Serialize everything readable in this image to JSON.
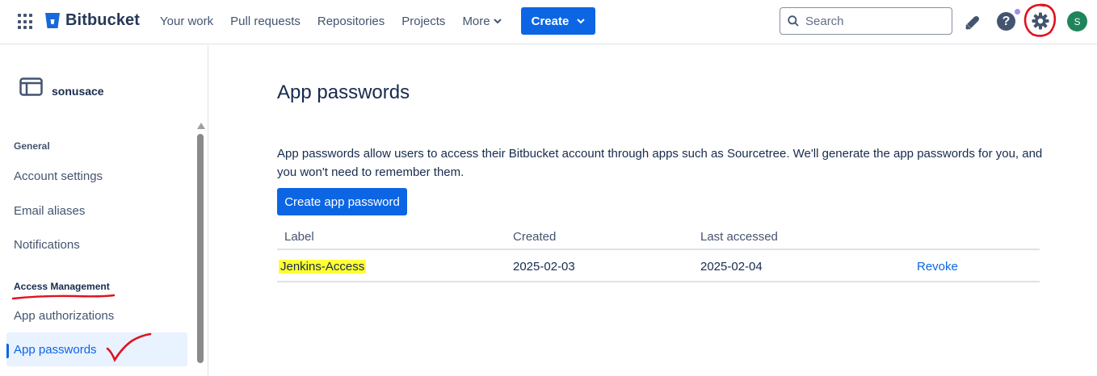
{
  "topnav": {
    "app_name": "Bitbucket",
    "nav_items": [
      "Your work",
      "Pull requests",
      "Repositories",
      "Projects"
    ],
    "more_label": "More",
    "create_label": "Create",
    "search_placeholder": "Search",
    "help_label": "?",
    "avatar_initial": "S"
  },
  "sidebar": {
    "workspace_name": "sonusace",
    "section_general": "General",
    "general_items": [
      "Account settings",
      "Email aliases",
      "Notifications"
    ],
    "section_access": "Access Management",
    "access_items": [
      "App authorizations",
      "App passwords"
    ]
  },
  "main": {
    "title": "App passwords",
    "description": "App passwords allow users to access their Bitbucket account through apps such as Sourcetree. We'll generate the app passwords for you, and you won't need to remember them.",
    "create_button": "Create app password",
    "table": {
      "headers": [
        "Label",
        "Created",
        "Last accessed"
      ],
      "rows": [
        {
          "label": "Jenkins-Access",
          "created": "2025-02-03",
          "last_accessed": "2025-02-04",
          "action": "Revoke"
        }
      ]
    }
  },
  "colors": {
    "brand_blue": "#0c66e4",
    "highlight": "#ffff33",
    "annotation_red": "#e0121f"
  }
}
